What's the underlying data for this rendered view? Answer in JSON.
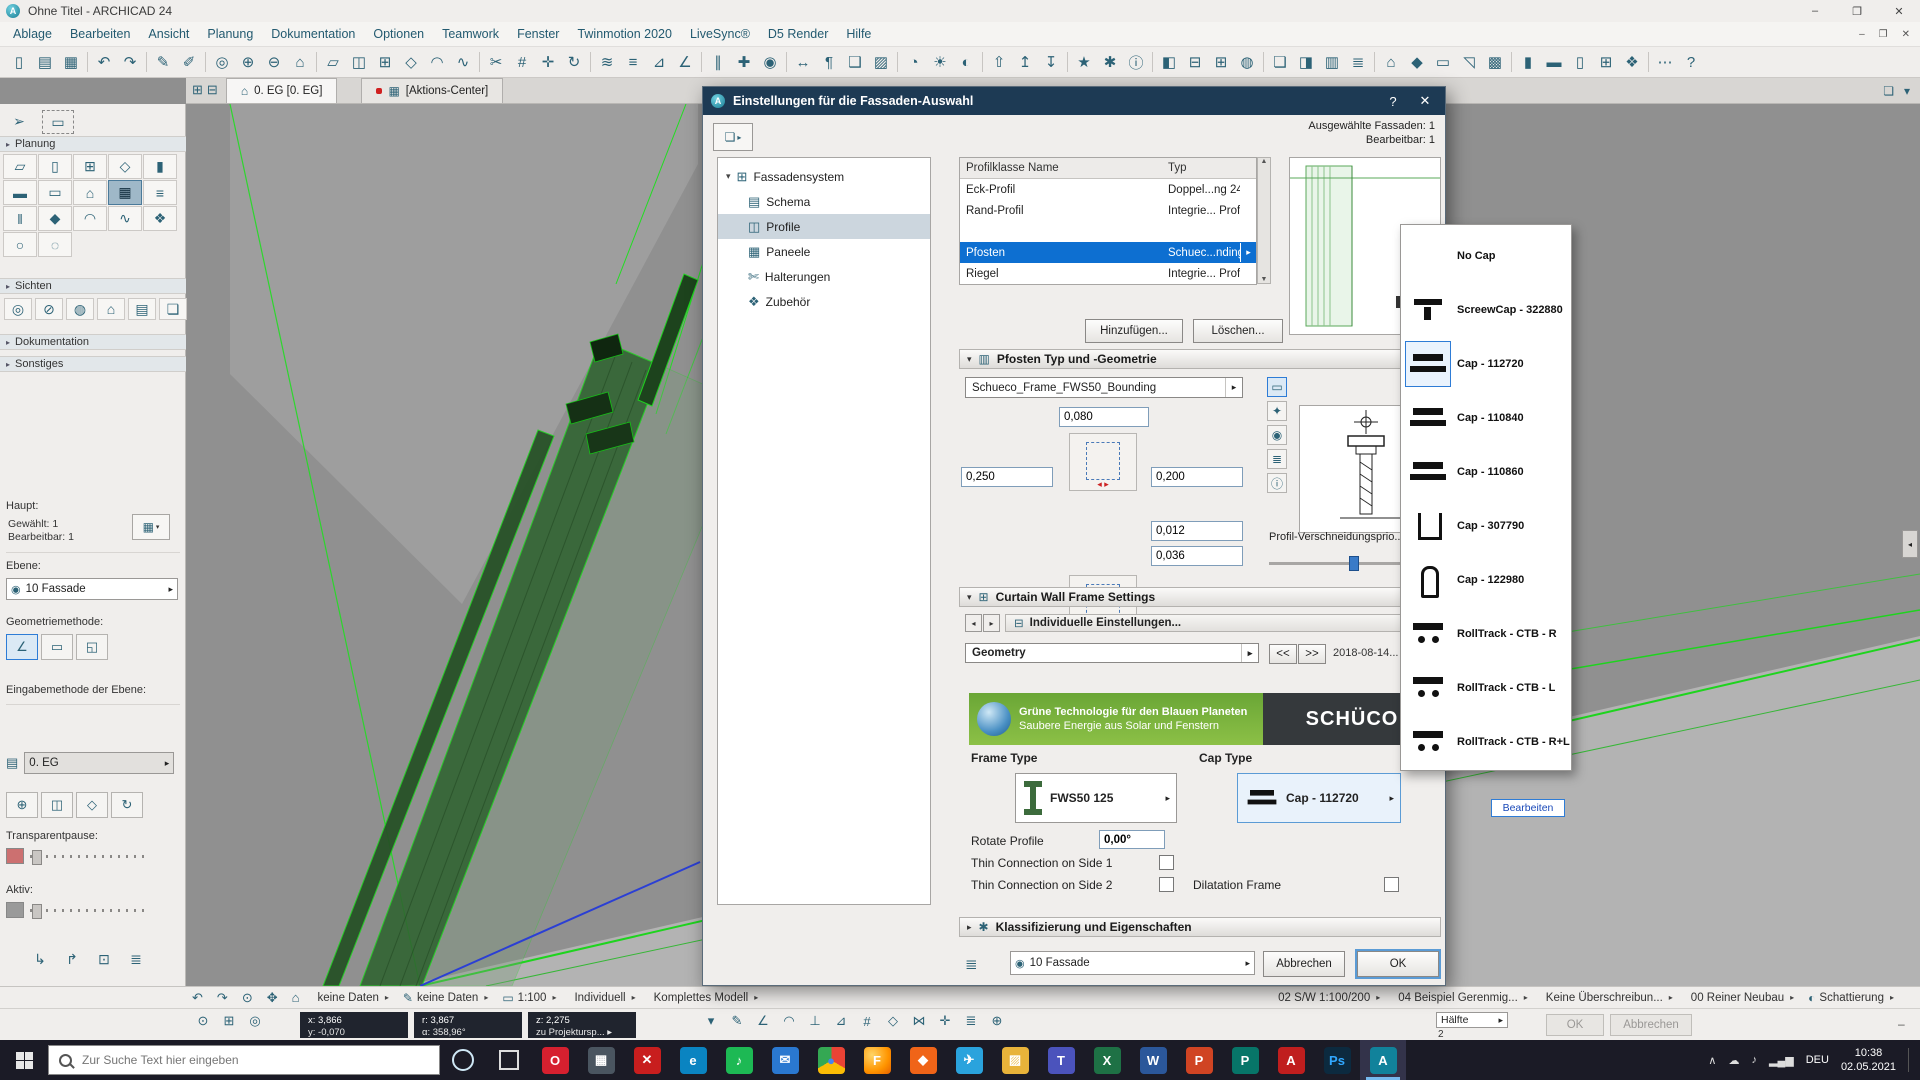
{
  "icons": {
    "dd": "▾",
    "tri": "▸",
    "tri_l": "◂",
    "close": "✕",
    "min": "–",
    "max": "❐",
    "help": "?",
    "expand": "▾",
    "collapse": "▸",
    "dash": "–"
  },
  "window": {
    "title": "Ohne Titel - ARCHICAD 24",
    "logo_letter": "A"
  },
  "menubar": [
    "Ablage",
    "Bearbeiten",
    "Ansicht",
    "Planung",
    "Dokumentation",
    "Optionen",
    "Teamwork",
    "Fenster",
    "Twinmotion 2020",
    "LiveSync®",
    "D5 Render",
    "Hilfe"
  ],
  "toolbar": [
    {
      "name": "new-file-icon",
      "glyph": "▯"
    },
    {
      "name": "open-file-icon",
      "glyph": "▤"
    },
    {
      "name": "save-icon",
      "glyph": "▦"
    },
    {
      "sep": true
    },
    {
      "name": "undo-icon",
      "glyph": "↶"
    },
    {
      "name": "redo-icon",
      "glyph": "↷",
      "dd": true
    },
    {
      "sep": true
    },
    {
      "name": "pickup-parameters-icon",
      "glyph": "✎"
    },
    {
      "name": "inject-parameters-icon",
      "glyph": "✐"
    },
    {
      "sep": true
    },
    {
      "name": "find-select-icon",
      "glyph": "◎"
    },
    {
      "name": "zoom-in-icon",
      "glyph": "⊕"
    },
    {
      "name": "zoom-out-icon",
      "glyph": "⊖"
    },
    {
      "name": "fit-view-icon",
      "glyph": "⌂"
    },
    {
      "sep": true
    },
    {
      "name": "wall-mode-icon",
      "glyph": "▱"
    },
    {
      "name": "mirror-icon",
      "glyph": "◫"
    },
    {
      "name": "grid-snap-icon",
      "glyph": "⊞",
      "dd": true
    },
    {
      "name": "fillet-icon",
      "glyph": "◇"
    },
    {
      "name": "arc-icon",
      "glyph": "◠"
    },
    {
      "name": "spline-icon",
      "glyph": "∿"
    },
    {
      "sep": true
    },
    {
      "name": "split-icon",
      "glyph": "✂"
    },
    {
      "name": "intersect-icon",
      "glyph": "#"
    },
    {
      "name": "move-icon",
      "glyph": "✛"
    },
    {
      "name": "rotate-icon",
      "glyph": "↻"
    },
    {
      "sep": true
    },
    {
      "name": "trim-icon",
      "glyph": "≋"
    },
    {
      "name": "layers-icon",
      "glyph": "≡",
      "dd": true
    },
    {
      "name": "measure-icon",
      "glyph": "⊿"
    },
    {
      "name": "angle-icon",
      "glyph": "∠"
    },
    {
      "sep": true
    },
    {
      "name": "guide-lines-icon",
      "glyph": "∥"
    },
    {
      "name": "snap-guides-icon",
      "glyph": "✚",
      "dd": true
    },
    {
      "name": "gravity-icon",
      "glyph": "◉",
      "dd": true
    },
    {
      "sep": true
    },
    {
      "name": "dimension-icon",
      "glyph": "↔"
    },
    {
      "name": "text-icon",
      "glyph": "¶"
    },
    {
      "name": "label-icon",
      "glyph": "❑"
    },
    {
      "name": "hatch-icon",
      "glyph": "▨"
    },
    {
      "sep": true
    },
    {
      "name": "camera-icon",
      "glyph": "◔"
    },
    {
      "name": "sun-icon",
      "glyph": "☀"
    },
    {
      "name": "render-icon",
      "glyph": "◐"
    },
    {
      "sep": true
    },
    {
      "name": "publish-icon",
      "glyph": "⇧"
    },
    {
      "name": "teamwork-send-icon",
      "glyph": "↥"
    },
    {
      "name": "teamwork-receive-icon",
      "glyph": "↧"
    },
    {
      "sep": true
    },
    {
      "name": "favorites-icon",
      "glyph": "★"
    },
    {
      "name": "settings-icon",
      "glyph": "✱"
    },
    {
      "name": "info-icon",
      "glyph": "ⓘ"
    },
    {
      "sep": true
    },
    {
      "name": "3d-view-icon",
      "glyph": "◧"
    },
    {
      "name": "section-icon",
      "glyph": "⊟"
    },
    {
      "name": "elevation-icon",
      "glyph": "⊞"
    },
    {
      "name": "detail-icon",
      "glyph": "◍"
    },
    {
      "sep": true
    },
    {
      "name": "layout-book-icon",
      "glyph": "❏"
    },
    {
      "name": "organizer-icon",
      "glyph": "◨"
    },
    {
      "name": "schedule-icon",
      "glyph": "▥"
    },
    {
      "name": "list-icon",
      "glyph": "≣"
    },
    {
      "sep": true
    },
    {
      "name": "zone-icon",
      "glyph": "⌂"
    },
    {
      "name": "morph-icon",
      "glyph": "◆"
    },
    {
      "name": "slab-icon",
      "glyph": "▭"
    },
    {
      "name": "roof-icon",
      "glyph": "◹"
    },
    {
      "name": "mesh-icon",
      "glyph": "▩"
    },
    {
      "sep": true
    },
    {
      "name": "column-icon",
      "glyph": "▮"
    },
    {
      "name": "beam-icon",
      "glyph": "▬"
    },
    {
      "name": "door-icon",
      "glyph": "▯"
    },
    {
      "name": "window-icon",
      "glyph": "⊞"
    },
    {
      "name": "object-icon",
      "glyph": "❖"
    },
    {
      "sep": true
    },
    {
      "name": "options-icon",
      "glyph": "⋯"
    },
    {
      "name": "help-icon",
      "glyph": "?"
    }
  ],
  "tabbar": {
    "tab1": "0. EG [0. EG]",
    "tab2": "[Aktions-Center]"
  },
  "toolbox": {
    "sections": {
      "planung": "Planung",
      "sichten": "Sichten",
      "dokumentation": "Dokumentation",
      "sonstiges": "Sonstiges"
    },
    "tools": [
      {
        "name": "tool-wand",
        "glyph": "▱"
      },
      {
        "name": "tool-tuer",
        "glyph": "▯"
      },
      {
        "name": "tool-fenster",
        "glyph": "⊞"
      },
      {
        "name": "tool-oberlicht",
        "glyph": "◇"
      },
      {
        "name": "tool-stuetze",
        "glyph": "▮"
      },
      {
        "name": "tool-unterzug",
        "glyph": "▬"
      },
      {
        "name": "tool-decke",
        "glyph": "▭"
      },
      {
        "name": "tool-dach",
        "glyph": "⌂"
      },
      {
        "name": "tool-fassade",
        "glyph": "▦",
        "selected": true
      },
      {
        "name": "tool-treppe",
        "glyph": "≡"
      },
      {
        "name": "tool-gelaender",
        "glyph": "‖"
      },
      {
        "name": "tool-morph",
        "glyph": "◆"
      },
      {
        "name": "tool-schale",
        "glyph": "◠"
      },
      {
        "name": "tool-freiflaeche",
        "glyph": "∿"
      },
      {
        "name": "tool-objekt",
        "glyph": "❖"
      },
      {
        "name": "tool-lampe",
        "glyph": "○"
      },
      {
        "name": "tool-oeffnung",
        "glyph": "◌"
      }
    ],
    "sichten_tools": [
      {
        "name": "viewpoint-icon",
        "glyph": "◎"
      },
      {
        "name": "schnitt-icon",
        "glyph": "⊘"
      },
      {
        "name": "ansicht-icon",
        "glyph": "◍"
      },
      {
        "name": "innenansicht-icon",
        "glyph": "⌂"
      },
      {
        "name": "arbeitsblatt-icon",
        "glyph": "▤"
      },
      {
        "name": "detail-icon",
        "glyph": "❏"
      }
    ],
    "haupt_label": "Haupt:",
    "gewaehlt": "Gewählt: 1",
    "bearbeitbar": "Bearbeitbar: 1",
    "ebene_label": "Ebene:",
    "ebene_value": "10 Fassade",
    "geom_label": "Geometriemethode:",
    "geom_tools": [
      {
        "name": "geom-polyline-icon",
        "glyph": "∠",
        "selected": true
      },
      {
        "name": "geom-rect-icon",
        "glyph": "▭"
      },
      {
        "name": "geom-rotrect-icon",
        "glyph": "◱"
      }
    ],
    "eingabe_label": "Eingabemethode der Ebene:",
    "story_value": "0. EG",
    "row_tools": [
      {
        "name": "offset-icon",
        "glyph": "⊕"
      },
      {
        "name": "mirror-icon",
        "glyph": "◫"
      },
      {
        "name": "corner-icon",
        "glyph": "◇"
      },
      {
        "name": "rotate-icon",
        "glyph": "↻"
      }
    ],
    "transparent_label": "Transparentpause:",
    "aktiv_label": "Aktiv:",
    "bottom_tools": [
      {
        "name": "dock-left-icon",
        "glyph": "↳"
      },
      {
        "name": "dock-right-icon",
        "glyph": "↱"
      },
      {
        "name": "panel-icon",
        "glyph": "⊡"
      },
      {
        "name": "list-icon",
        "glyph": "≣"
      }
    ]
  },
  "dialog": {
    "title": "Einstellungen für die Fassaden-Auswahl",
    "info1": "Ausgewählte Fassaden: 1",
    "info2": "Bearbeitbar: 1",
    "tree_root": "Fassadensystem",
    "tree_items": [
      {
        "label": "Schema",
        "glyph": "▤"
      },
      {
        "label": "Profile",
        "glyph": "◫",
        "selected": true
      },
      {
        "label": "Paneele",
        "glyph": "▦"
      },
      {
        "label": "Halterungen",
        "glyph": "✄"
      },
      {
        "label": "Zubehör",
        "glyph": "❖"
      }
    ],
    "table_h1": "Profilklasse Name",
    "table_h2": "Typ",
    "table_rows": [
      {
        "name": "Eck-Profil",
        "typ": "Doppel...ng 24"
      },
      {
        "name": "Rand-Profil",
        "typ": "Integrie... Profil"
      },
      {
        "name": "",
        "typ": ""
      },
      {
        "name": "Pfosten",
        "typ": "Schuec...nding",
        "selected": true
      },
      {
        "name": "Riegel",
        "typ": "Integrie... Profil"
      }
    ],
    "btn_add": "Hinzufügen...",
    "btn_del": "Löschen...",
    "sec_pfosten": "Pfosten Typ und -Geometrie",
    "sec_cwfs": "Curtain Wall Frame Settings",
    "sec_klass": "Klassifizierung und Eigenschaften",
    "profile_dropdown": "Schueco_Frame_FWS50_Bounding",
    "side_icons": [
      {
        "name": "bounding-box-icon",
        "glyph": "▭",
        "selected": true
      },
      {
        "name": "flag-icon",
        "glyph": "✦"
      },
      {
        "name": "material-icon",
        "glyph": "◉"
      },
      {
        "name": "list-icon",
        "glyph": "≣"
      },
      {
        "name": "info-icon",
        "glyph": "ⓘ"
      }
    ],
    "fld_top": "0,080",
    "fld_left": "0,250",
    "fld_right": "0,200",
    "fld_a": "0,012",
    "fld_b": "0,036",
    "prio_label": "Profil-Verschneidungsprio...",
    "indiv": "Individuelle Einstellungen...",
    "geometry": "Geometry",
    "nav_back": "<<",
    "nav_fwd": ">>",
    "date": "2018-08-14...",
    "banner_line1": "Grüne Technologie für den Blauen Planeten",
    "banner_line2": "Saubere Energie aus Solar und Fenstern",
    "brand": "SCHÜCO",
    "frame_type_label": "Frame Type",
    "cap_type_label": "Cap Type",
    "frame_type_value": "FWS50 125",
    "cap_type_value": "Cap - 112720",
    "rotate_label": "Rotate Profile",
    "rotate_value": "0,00°",
    "thin1": "Thin Connection on Side 1",
    "thin2": "Thin Connection on Side 2",
    "dilatation": "Dilatation Frame",
    "layer_value": "10 Fassade",
    "cancel": "Abbrechen",
    "ok": "OK"
  },
  "cap_list": [
    {
      "label": "No Cap",
      "icon": "none"
    },
    {
      "label": "ScreewCap - 322880",
      "icon": "screwcap-icon"
    },
    {
      "label": "Cap - 112720",
      "icon": "cap-icon",
      "selected": true
    },
    {
      "label": "Cap - 110840",
      "icon": "cap-icon"
    },
    {
      "label": "Cap - 110860",
      "icon": "cap-icon"
    },
    {
      "label": "Cap - 307790",
      "icon": "capu-icon"
    },
    {
      "label": "Cap - 122980",
      "icon": "bullet-icon"
    },
    {
      "label": "RollTrack - CTB - R",
      "icon": "rolltrack-icon"
    },
    {
      "label": "RollTrack - CTB - L",
      "icon": "rolltrack-icon"
    },
    {
      "label": "RollTrack - CTB - R+L",
      "icon": "rolltrack-icon"
    }
  ],
  "edit_button": "Bearbeiten",
  "statusbar": {
    "left_icons": [
      {
        "name": "back-icon",
        "glyph": "↶"
      },
      {
        "name": "forward-icon",
        "glyph": "↷"
      },
      {
        "name": "zoom-icon",
        "glyph": "⊙"
      },
      {
        "name": "pan-icon",
        "glyph": "✥"
      },
      {
        "name": "home-icon",
        "glyph": "⌂"
      }
    ],
    "items_left": [
      {
        "label": "keine Daten"
      },
      {
        "icon": "✎",
        "label": "keine Daten"
      },
      {
        "icon": "▭",
        "label": "1:100"
      },
      {
        "label": "Individuell"
      },
      {
        "label": "Komplettes Modell"
      }
    ],
    "items_right": [
      {
        "label": "02 S/W 1:100/200"
      },
      {
        "label": "04 Beispiel Gerenmig..."
      },
      {
        "label": "Keine Überschreibun..."
      },
      {
        "label": "00 Reiner Neubau"
      },
      {
        "icon": "◐",
        "label": "Schattierung"
      }
    ]
  },
  "tracker": {
    "left_icons": [
      {
        "name": "zoom-icon",
        "glyph": "⊙"
      },
      {
        "name": "grid-icon",
        "glyph": "⊞"
      },
      {
        "name": "target-icon",
        "glyph": "◎"
      }
    ],
    "panels": [
      {
        "l1": "x: 3,866",
        "l2": "y: -0,070"
      },
      {
        "l1": "r: 3,867",
        "l2": "α: 358,96°"
      },
      {
        "l1": "z: 2,275",
        "l2": "zu Projektursp... ▸"
      }
    ],
    "icons": [
      {
        "name": "dropdown-icon",
        "glyph": "▾"
      },
      {
        "name": "pencil-icon",
        "glyph": "✎"
      },
      {
        "name": "angle-icon",
        "glyph": "∠"
      },
      {
        "name": "arc-icon",
        "glyph": "◠"
      },
      {
        "name": "perpendicular-icon",
        "glyph": "⊥"
      },
      {
        "name": "triangle-icon",
        "glyph": "⊿"
      },
      {
        "name": "hash-icon",
        "glyph": "#"
      },
      {
        "name": "diamond-icon",
        "glyph": "◇"
      },
      {
        "name": "bowtie-icon",
        "glyph": "⋈"
      },
      {
        "name": "plus-icon",
        "glyph": "✛"
      },
      {
        "name": "list-icon",
        "glyph": "≣"
      },
      {
        "name": "oplus-icon",
        "glyph": "⊕"
      }
    ],
    "haelfte": "Hälfte",
    "haelfte_sub": "2",
    "ok": "OK",
    "cancel": "Abbrechen"
  },
  "taskbar": {
    "search_placeholder": "Zur Suche Text hier eingeben",
    "apps": [
      {
        "name": "opera-icon",
        "label": "O",
        "style": "background:#d6202f"
      },
      {
        "name": "vm-icon",
        "label": "▦",
        "style": "background:#4a5560"
      },
      {
        "name": "x-app-icon",
        "label": "✕",
        "style": "background:#c81e1e"
      },
      {
        "name": "edge-icon",
        "label": "e",
        "style": "background:#0a84c1"
      },
      {
        "name": "spotify-icon",
        "label": "♪",
        "style": "background:#1db954"
      },
      {
        "name": "mail-icon",
        "label": "✉",
        "style": "background:#2a78d0"
      },
      {
        "name": "chrome-icon",
        "label": "●",
        "style": "background:conic-gradient(#ea4335 0 120deg,#fbbc05 0 240deg,#34a853 0 360deg);color:#4285f4"
      },
      {
        "name": "firefox-icon",
        "label": "F",
        "style": "background:radial-gradient(circle at 30% 30%,#ffd567,#ff9500 60%,#e66000)"
      },
      {
        "name": "flame-icon",
        "label": "◆",
        "style": "background:#f06418"
      },
      {
        "name": "plane-icon",
        "label": "✈",
        "style": "background:#2aa3dd"
      },
      {
        "name": "explorer-icon",
        "label": "▨",
        "style": "background:#e8b33a"
      },
      {
        "name": "teams-icon",
        "label": "T",
        "style": "background:#4b53bc"
      },
      {
        "name": "excel-icon",
        "label": "X",
        "style": "background:#1e7145"
      },
      {
        "name": "word-icon",
        "label": "W",
        "style": "background:#2b579a"
      },
      {
        "name": "powerpoint-icon",
        "label": "P",
        "style": "background:#d04423"
      },
      {
        "name": "publisher-icon",
        "label": "P",
        "style": "background:#077568"
      },
      {
        "name": "acrobat-icon",
        "label": "A",
        "style": "background:#c01e1e"
      },
      {
        "name": "photoshop-icon",
        "label": "Ps",
        "style": "background:#0c2a3f;color:#31a8ff"
      },
      {
        "name": "archicad-icon",
        "label": "A",
        "style": "background:#11829b",
        "active": true
      }
    ],
    "tray": [
      {
        "name": "hidden-icons-chevron",
        "glyph": "∧"
      },
      {
        "name": "onedrive-icon",
        "glyph": "☁"
      },
      {
        "name": "volume-icon",
        "glyph": "♪"
      },
      {
        "name": "network-icon",
        "glyph": "▂▄▆"
      }
    ],
    "lang": "DEU",
    "time": "10:38",
    "date": "02.05.2021"
  }
}
